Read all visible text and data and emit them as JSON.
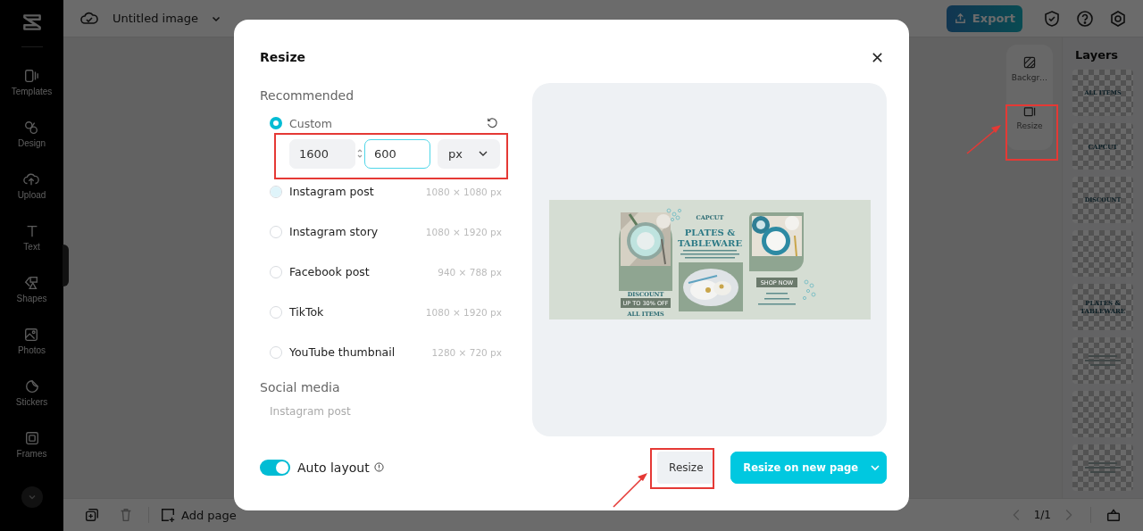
{
  "app_bar": {
    "title": "Untitled image",
    "export": "Export"
  },
  "sidebar": {
    "items": [
      {
        "label": "Templates"
      },
      {
        "label": "Design"
      },
      {
        "label": "Upload"
      },
      {
        "label": "Text"
      },
      {
        "label": "Shapes"
      },
      {
        "label": "Photos"
      },
      {
        "label": "Stickers"
      },
      {
        "label": "Frames"
      }
    ]
  },
  "side_tools": [
    {
      "label": "Backgr…"
    },
    {
      "label": "Resize"
    }
  ],
  "layers": {
    "title": "Layers",
    "thumbnails": [
      {
        "kind": "text",
        "text": "ALL ITEMS"
      },
      {
        "kind": "text",
        "text": "CAPCUT"
      },
      {
        "kind": "text",
        "text": "DISCOUNT"
      },
      {
        "kind": "blank"
      },
      {
        "kind": "text",
        "text": "PLATES & TABLEWARE"
      },
      {
        "kind": "lines"
      },
      {
        "kind": "blank"
      },
      {
        "kind": "lines"
      }
    ]
  },
  "bottom_bar": {
    "add_page": "Add page",
    "page": "1/1"
  },
  "dialog": {
    "title": "Resize",
    "recommended": "Recommended",
    "presets": [
      {
        "kind": "custom",
        "label": "Custom",
        "selected": true,
        "hovered": false
      },
      {
        "kind": "preset",
        "label": "Instagram post",
        "size": "1080 × 1080 px",
        "selected": false,
        "hovered": true
      },
      {
        "kind": "preset",
        "label": "Instagram story",
        "size": "1080 × 1920 px",
        "selected": false,
        "hovered": false
      },
      {
        "kind": "preset",
        "label": "Facebook post",
        "size": "940 × 788 px",
        "selected": false,
        "hovered": false
      },
      {
        "kind": "preset",
        "label": "TikTok",
        "size": "1080 × 1920 px",
        "selected": false,
        "hovered": false
      },
      {
        "kind": "preset",
        "label": "YouTube thumbnail",
        "size": "1280 × 720 px",
        "selected": false,
        "hovered": false
      }
    ],
    "custom": {
      "width": {
        "value": "1600",
        "focused": false
      },
      "height": {
        "value": "600",
        "focused": true
      },
      "unit": "px"
    },
    "social_media": {
      "heading": "Social media",
      "items": [
        "Instagram post"
      ]
    },
    "auto_layout": {
      "label": "Auto layout",
      "on": true
    },
    "design": {
      "brand": "CAPCUT",
      "headline": "PLATES & TABLEWARE",
      "discount": "DISCOUNT",
      "offer": "UP TO 30% OFF",
      "items": "ALL ITEMS",
      "cta": "SHOP NOW"
    },
    "buttons": {
      "resize": "Resize",
      "resize_new": "Resize on new page"
    }
  }
}
